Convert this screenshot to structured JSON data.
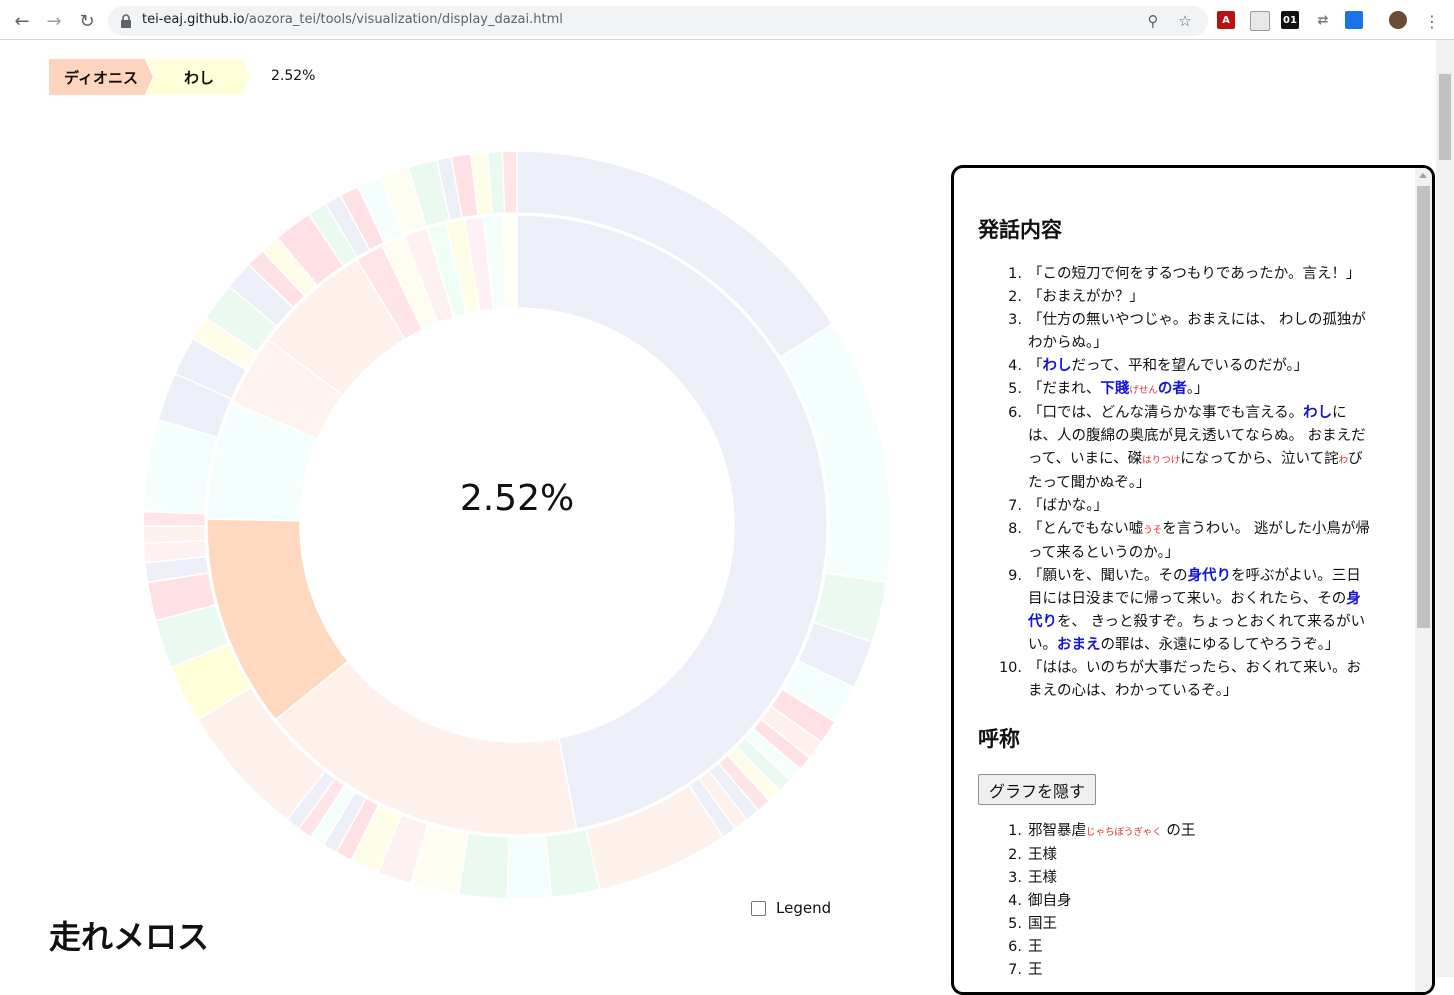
{
  "browser": {
    "url_host": "tei-eaj.github.io",
    "url_path": "/aozora_tei/tools/visualization/display_dazai.html"
  },
  "breadcrumb": {
    "items": [
      "ディオニス",
      "わし"
    ],
    "percentage": "2.52%"
  },
  "chart_data": {
    "type": "sunburst",
    "center_label": "2.52%",
    "rings": [
      {
        "name": "inner",
        "segments": [
          {
            "value": 38,
            "color": "#eceef8"
          },
          {
            "value": 14,
            "color": "#fef1ec"
          },
          {
            "value": 9,
            "color": "#fed8bf"
          },
          {
            "value": 5,
            "color": "#f4fffd"
          },
          {
            "value": 3,
            "color": "#fef3ee"
          },
          {
            "value": 5,
            "color": "#fef1ec"
          },
          {
            "value": 1.2,
            "color": "#ffe4e8"
          },
          {
            "value": 1.0,
            "color": "#fefef0"
          },
          {
            "value": 1.0,
            "color": "#fff0f2"
          },
          {
            "value": 0.8,
            "color": "#f0fff6"
          },
          {
            "value": 0.8,
            "color": "#fefee8"
          },
          {
            "value": 0.8,
            "color": "#fff0f5"
          },
          {
            "value": 0.8,
            "color": "#f4fff9"
          },
          {
            "value": 0.6,
            "color": "#fefef2"
          }
        ]
      },
      {
        "name": "outer",
        "segments": [
          {
            "value": 15.3,
            "color": "#eceef8"
          },
          {
            "value": 11,
            "color": "#f4fffd"
          },
          {
            "value": 2.5,
            "color": "#eafaf1"
          },
          {
            "value": 2,
            "color": "#eceef8"
          },
          {
            "value": 1.6,
            "color": "#f4fffd"
          },
          {
            "value": 1,
            "color": "#ffe0e5"
          },
          {
            "value": 0.8,
            "color": "#fef1ec"
          },
          {
            "value": 0.6,
            "color": "#ffe0e5"
          },
          {
            "value": 0.6,
            "color": "#f4fffd"
          },
          {
            "value": 0.6,
            "color": "#eafaf1"
          },
          {
            "value": 0.6,
            "color": "#fefee8"
          },
          {
            "value": 0.6,
            "color": "#ffe4e8"
          },
          {
            "value": 0.6,
            "color": "#eceef8"
          },
          {
            "value": 0.6,
            "color": "#fef1ec"
          },
          {
            "value": 0.6,
            "color": "#eceef8"
          },
          {
            "value": 5.5,
            "color": "#fef1ec"
          },
          {
            "value": 2,
            "color": "#eafaf1"
          },
          {
            "value": 1.8,
            "color": "#f4fffd"
          },
          {
            "value": 2,
            "color": "#eafaf1"
          },
          {
            "value": 2,
            "color": "#fefef0"
          },
          {
            "value": 1.4,
            "color": "#fff0f2"
          },
          {
            "value": 1.2,
            "color": "#fefee8"
          },
          {
            "value": 0.7,
            "color": "#ffe0e5"
          },
          {
            "value": 0.6,
            "color": "#eceef8"
          },
          {
            "value": 0.6,
            "color": "#f4fffd"
          },
          {
            "value": 0.6,
            "color": "#ffe4e8"
          },
          {
            "value": 0.6,
            "color": "#eceef8"
          },
          {
            "value": 5.5,
            "color": "#fef1ec"
          },
          {
            "value": 2.4,
            "color": "#fefed8"
          },
          {
            "value": 2,
            "color": "#eafaf1"
          },
          {
            "value": 1.6,
            "color": "#ffe0e5"
          },
          {
            "value": 0.8,
            "color": "#eceef8"
          },
          {
            "value": 0.8,
            "color": "#fff0f2"
          },
          {
            "value": 0.7,
            "color": "#fef1ec"
          },
          {
            "value": 0.6,
            "color": "#ffe4e8"
          },
          {
            "value": 3.8,
            "color": "#f4fffd"
          },
          {
            "value": 2,
            "color": "#eceef8"
          },
          {
            "value": 1.6,
            "color": "#eceef8"
          },
          {
            "value": 1,
            "color": "#fefee8"
          },
          {
            "value": 1.6,
            "color": "#eafaf1"
          },
          {
            "value": 1.2,
            "color": "#eceef8"
          },
          {
            "value": 0.8,
            "color": "#ffe0e5"
          },
          {
            "value": 0.8,
            "color": "#fefee8"
          },
          {
            "value": 1.6,
            "color": "#ffe0e5"
          },
          {
            "value": 0.8,
            "color": "#eafaf1"
          },
          {
            "value": 0.7,
            "color": "#eceef8"
          },
          {
            "value": 0.8,
            "color": "#ffe0e5"
          },
          {
            "value": 1,
            "color": "#f4fffd"
          },
          {
            "value": 1.2,
            "color": "#fefef0"
          },
          {
            "value": 1.2,
            "color": "#eafaf1"
          },
          {
            "value": 0.6,
            "color": "#eceef8"
          },
          {
            "value": 0.8,
            "color": "#ffe0e5"
          },
          {
            "value": 0.7,
            "color": "#fefee8"
          },
          {
            "value": 0.6,
            "color": "#eafaf1"
          },
          {
            "value": 0.6,
            "color": "#ffe4e8"
          }
        ]
      }
    ]
  },
  "legend": {
    "label": "Legend",
    "checked": false
  },
  "story_title": "走れメロス",
  "panel": {
    "utterances_heading": "発話内容",
    "utterances": [
      [
        {
          "t": "「この短刀で何をするつもりであったか。言え！」"
        }
      ],
      [
        {
          "t": "「おまえがか？」"
        }
      ],
      [
        {
          "t": "「仕方の無いやつじゃ。おまえには、 わしの孤独がわからぬ。」"
        }
      ],
      [
        {
          "t": "「"
        },
        {
          "t": "わし",
          "c": "hl"
        },
        {
          "t": "だって、平和を望んでいるのだが。」"
        }
      ],
      [
        {
          "t": "「だまれ、"
        },
        {
          "t": "下賤",
          "c": "hl"
        },
        {
          "t": "げせん",
          "c": "ruby"
        },
        {
          "t": "の者",
          "c": "hl"
        },
        {
          "t": "。」"
        }
      ],
      [
        {
          "t": "「口では、どんな清らかな事でも言える。"
        },
        {
          "t": "わし",
          "c": "hl"
        },
        {
          "t": "には、人の腹綿の奥底が見え透いてならぬ。 おまえだって、いまに、磔"
        },
        {
          "t": "はりつけ",
          "c": "ruby"
        },
        {
          "t": "になってから、泣いて詫"
        },
        {
          "t": "わ",
          "c": "ruby"
        },
        {
          "t": "びたって聞かぬぞ。」"
        }
      ],
      [
        {
          "t": "「ばかな。」"
        }
      ],
      [
        {
          "t": "「とんでもない嘘"
        },
        {
          "t": "うそ",
          "c": "ruby"
        },
        {
          "t": "を言うわい。 逃がした小鳥が帰って来るというのか。」"
        }
      ],
      [
        {
          "t": "「願いを、聞いた。その"
        },
        {
          "t": "身代り",
          "c": "hl"
        },
        {
          "t": "を呼ぶがよい。三日目には日没までに帰って来い。おくれたら、その"
        },
        {
          "t": "身代り",
          "c": "hl"
        },
        {
          "t": "を、 きっと殺すぞ。ちょっとおくれて来るがいい。"
        },
        {
          "t": "おまえ",
          "c": "hl"
        },
        {
          "t": "の罪は、永遠にゆるしてやろうぞ。」"
        }
      ],
      [
        {
          "t": "「はは。いのちが大事だったら、おくれて来い。おまえの心は、わかっているぞ。」"
        }
      ]
    ],
    "names_heading": "呼称",
    "hide_button_label": "グラフを隠す",
    "names": [
      [
        {
          "t": "邪智暴虐"
        },
        {
          "t": "じゃちぼうぎゃく",
          "c": "ruby"
        },
        {
          "t": " の王"
        }
      ],
      [
        {
          "t": "王様"
        }
      ],
      [
        {
          "t": "王様"
        }
      ],
      [
        {
          "t": "御自身"
        }
      ],
      [
        {
          "t": "国王"
        }
      ],
      [
        {
          "t": "王"
        }
      ],
      [
        {
          "t": "王"
        }
      ]
    ]
  }
}
